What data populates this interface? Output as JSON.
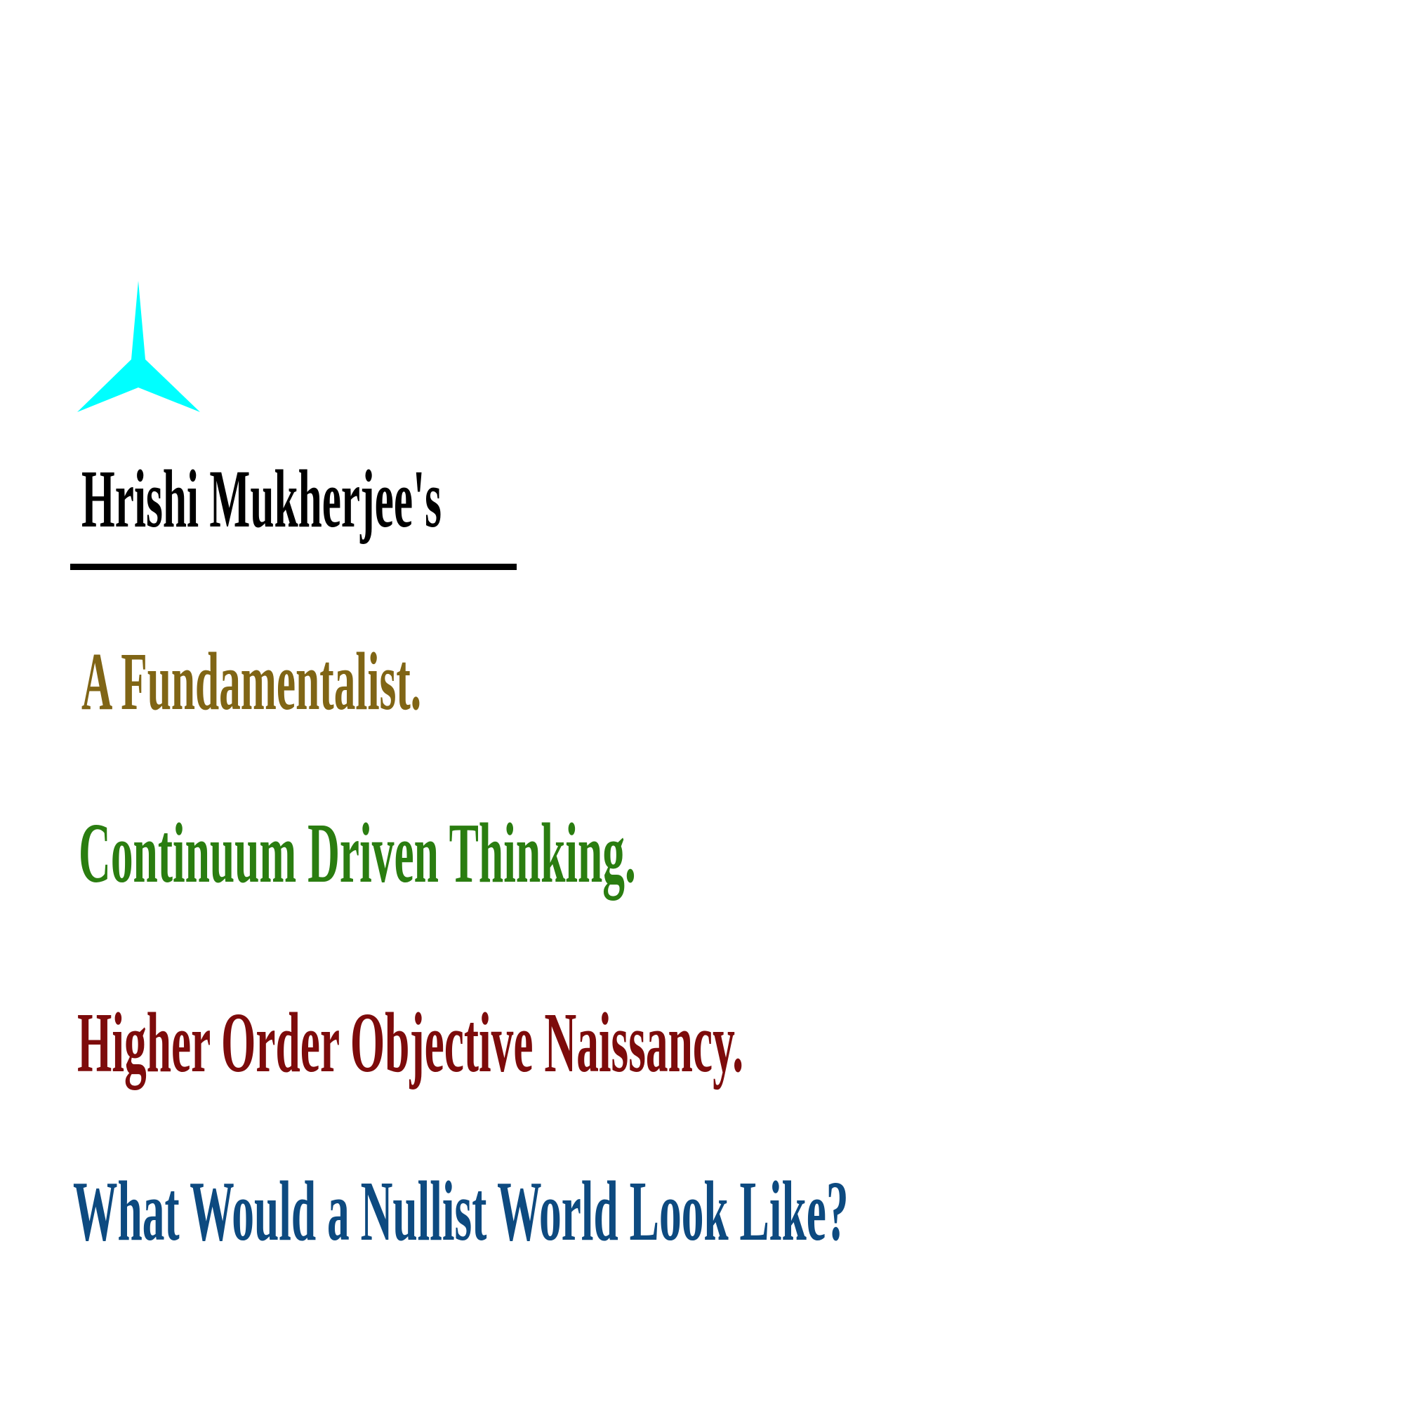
{
  "logo": {
    "icon": "cyan-three-point-star-icon",
    "color": "#00ffff"
  },
  "author": {
    "text": "Hrishi Mukherjee's",
    "color": "#000000"
  },
  "rule": {
    "color": "#000000"
  },
  "titles": [
    {
      "text": "A Fundamentalist.",
      "color": "#806515"
    },
    {
      "text": "Continuum Driven Thinking.",
      "color": "#2a7d10"
    },
    {
      "text": "Higher Order Objective Naissancy.",
      "color": "#7d0b0b"
    },
    {
      "text": "What Would a Nullist World Look Like?",
      "color": "#0d4a80"
    }
  ]
}
